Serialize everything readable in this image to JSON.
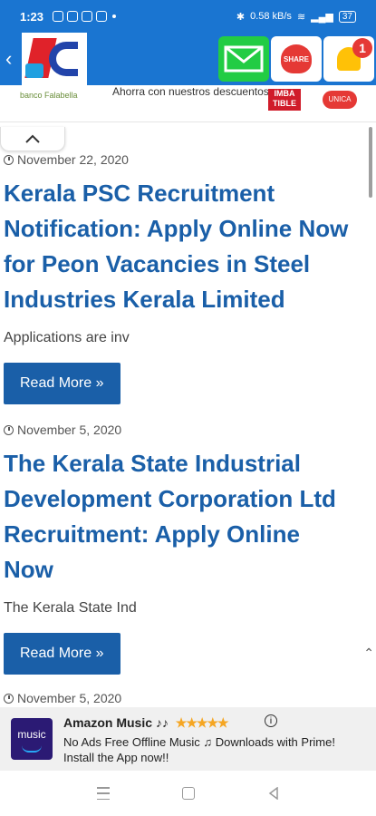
{
  "status_bar": {
    "time": "1:23",
    "speed": "0.58 kB/s",
    "battery": "37"
  },
  "appbar": {
    "back_glyph": "‹",
    "share_text": "SHARE",
    "notification_count": "1"
  },
  "top_ad": {
    "bank": "banco Falabella",
    "promo": "Ahorra con nuestros descuentos",
    "brand1": "IMBA TIBLE",
    "brand2": "UNICA"
  },
  "posts": [
    {
      "date": "November 22, 2020",
      "title_lines": [
        "Kerala PSC Recruitment",
        "Notification: Apply Online Now",
        "for Peon Vacancies in Steel",
        "Industries Kerala Limited"
      ],
      "excerpt": "Applications are inv",
      "cta": "Read More »"
    },
    {
      "date": "November 5, 2020",
      "title_lines": [
        "The Kerala State Industrial",
        "Development Corporation Ltd",
        "Recruitment: Apply Online",
        "Now"
      ],
      "excerpt": "The Kerala State Ind",
      "cta": "Read More »"
    },
    {
      "date": "November 5, 2020"
    }
  ],
  "bottom_ad": {
    "icon_text": "music",
    "title": "Amazon Music ♪♪",
    "rating_stars": 4.5,
    "description": "No Ads Free Offline Music ♫ Downloads with Prime! Install the App now!!"
  },
  "colors": {
    "brand": "#1a75d1",
    "link": "#1a5fa8"
  }
}
